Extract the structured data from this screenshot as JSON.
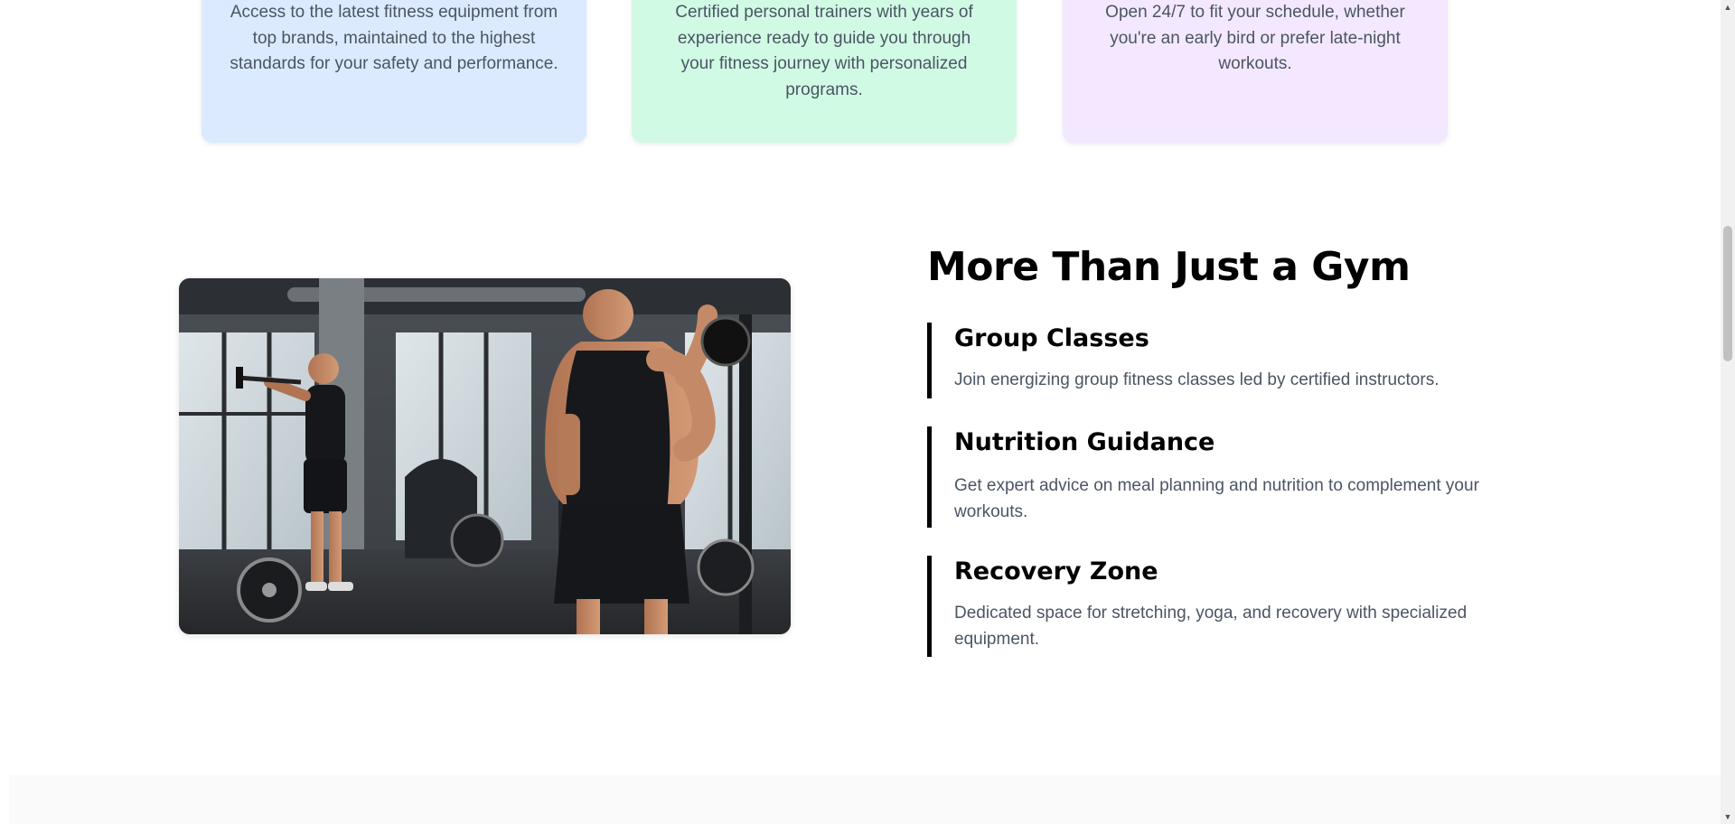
{
  "features": [
    {
      "text": "Access to the latest fitness equipment from top brands, maintained to the highest standards for your safety and performance.",
      "bg": "#dbeafe"
    },
    {
      "text": "Certified personal trainers with years of experience ready to guide you through your fitness journey with personalized programs.",
      "bg": "#d1fae5"
    },
    {
      "text": "Open 24/7 to fit your schedule, whether you're an early bird or prefer late-night workouts.",
      "bg": "#f3e8ff"
    }
  ],
  "section": {
    "title": "More Than Just a Gym",
    "offers": [
      {
        "title": "Group Classes",
        "description": "Join energizing group fitness classes led by certified instructors."
      },
      {
        "title": "Nutrition Guidance",
        "description": "Get expert advice on meal planning and nutrition to complement your workouts."
      },
      {
        "title": "Recovery Zone",
        "description": "Dedicated space for stretching, yoga, and recovery with specialized equipment."
      }
    ]
  },
  "image": {
    "icon": "gym-photo"
  },
  "scrollbar": {
    "up_icon": "▲",
    "down_icon": "▼"
  }
}
